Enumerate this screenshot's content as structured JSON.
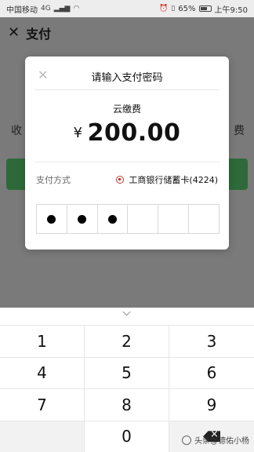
{
  "status_bar": {
    "carrier": "中国移动",
    "network": "4G",
    "battery": "65%",
    "battery_level": 0.65,
    "time": "上午9:50"
  },
  "page": {
    "title": "支付",
    "left_label": "收",
    "right_label": "费"
  },
  "modal": {
    "title": "请输入支付密码",
    "merchant": "云缴费",
    "currency": "¥",
    "amount": "200.00",
    "pay_method_label": "支付方式",
    "card_name": "工商银行储蓄卡(4224)",
    "pin_filled": 3,
    "pin_length": 6
  },
  "keypad": {
    "keys": [
      "1",
      "2",
      "3",
      "4",
      "5",
      "6",
      "7",
      "8",
      "9",
      "",
      "0",
      "del"
    ]
  },
  "watermark": {
    "text": "头条@德佑小杨"
  },
  "colors": {
    "overlay": "#6c6c6c",
    "accent_green": "#2e6a39",
    "bank_red": "#c0392b"
  }
}
